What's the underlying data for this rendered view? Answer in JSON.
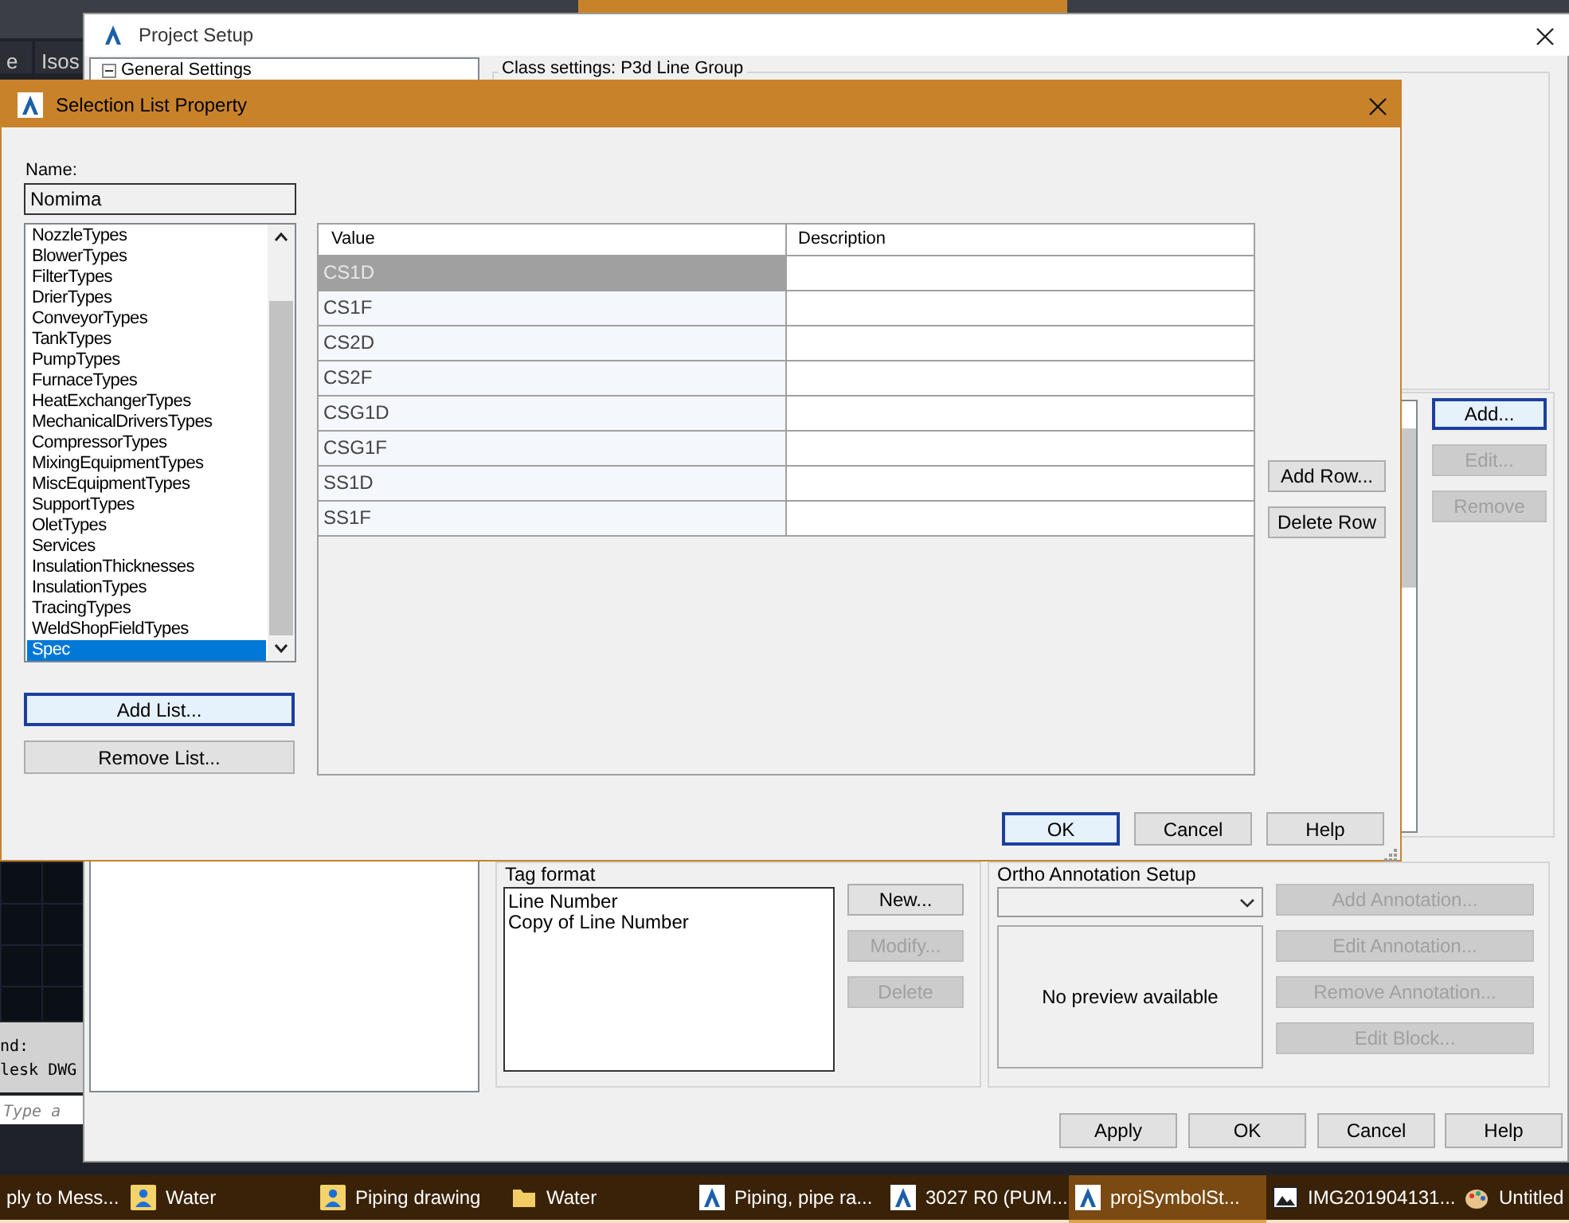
{
  "background_app": {
    "tabs": [
      {
        "label": "e"
      },
      {
        "label": "Isos"
      }
    ],
    "command_lines": [
      "nd:",
      "lesk DWG"
    ],
    "command_placeholder": "Type a"
  },
  "project_setup": {
    "title": "Project Setup",
    "tree": [
      {
        "label": "General Settings",
        "expanded": true
      }
    ],
    "class_settings_label": "Class settings: P3d Line Group",
    "side_buttons": [
      {
        "label": "Add...",
        "disabled": false,
        "focused": true
      },
      {
        "label": "Edit...",
        "disabled": true,
        "focused": false
      },
      {
        "label": "Remove",
        "disabled": true,
        "focused": false
      }
    ],
    "tag_format": {
      "legend": "Tag format",
      "items": [
        "Line Number",
        "Copy of Line Number"
      ],
      "buttons": [
        {
          "label": "New...",
          "disabled": false,
          "focused": false
        },
        {
          "label": "Modify...",
          "disabled": true,
          "focused": false
        },
        {
          "label": "Delete",
          "disabled": true,
          "focused": false
        }
      ]
    },
    "ortho_annotation": {
      "legend": "Ortho Annotation Setup",
      "preview_text": "No preview available",
      "buttons": [
        {
          "label": "Add Annotation...",
          "disabled": true,
          "focused": false
        },
        {
          "label": "Edit Annotation...",
          "disabled": true,
          "focused": false
        },
        {
          "label": "Remove Annotation...",
          "disabled": true,
          "focused": false
        },
        {
          "label": "Edit Block...",
          "disabled": true,
          "focused": false
        }
      ]
    },
    "footer_buttons": [
      {
        "label": "Apply",
        "disabled": false,
        "focused": false
      },
      {
        "label": "OK",
        "disabled": false,
        "focused": false
      },
      {
        "label": "Cancel",
        "disabled": false,
        "focused": false
      },
      {
        "label": "Help",
        "disabled": false,
        "focused": false
      }
    ]
  },
  "dialog": {
    "title": "Selection List Property",
    "name_label": "Name:",
    "name_value": "Nomima",
    "lists": [
      {
        "label": "NozzleTypes",
        "selected": false
      },
      {
        "label": "BlowerTypes",
        "selected": false
      },
      {
        "label": "FilterTypes",
        "selected": false
      },
      {
        "label": "DrierTypes",
        "selected": false
      },
      {
        "label": "ConveyorTypes",
        "selected": false
      },
      {
        "label": "TankTypes",
        "selected": false
      },
      {
        "label": "PumpTypes",
        "selected": false
      },
      {
        "label": "FurnaceTypes",
        "selected": false
      },
      {
        "label": "HeatExchangerTypes",
        "selected": false
      },
      {
        "label": "MechanicalDriversTypes",
        "selected": false
      },
      {
        "label": "CompressorTypes",
        "selected": false
      },
      {
        "label": "MixingEquipmentTypes",
        "selected": false
      },
      {
        "label": "MiscEquipmentTypes",
        "selected": false
      },
      {
        "label": "SupportTypes",
        "selected": false
      },
      {
        "label": "OletTypes",
        "selected": false
      },
      {
        "label": "Services",
        "selected": false
      },
      {
        "label": "InsulationThicknesses",
        "selected": false
      },
      {
        "label": "InsulationTypes",
        "selected": false
      },
      {
        "label": "TracingTypes",
        "selected": false
      },
      {
        "label": "WeldShopFieldTypes",
        "selected": false
      },
      {
        "label": "Spec",
        "selected": true
      }
    ],
    "list_buttons": [
      {
        "label": "Add List...",
        "disabled": false,
        "focused": true
      },
      {
        "label": "Remove List...",
        "disabled": false,
        "focused": false
      }
    ],
    "table": {
      "columns": [
        "Value",
        "Description"
      ],
      "rows": [
        {
          "value": "CS1D",
          "selected": true
        },
        {
          "value": "CS1F",
          "selected": false
        },
        {
          "value": "CS2D",
          "selected": false
        },
        {
          "value": "CS2F",
          "selected": false
        },
        {
          "value": "CSG1D",
          "selected": false
        },
        {
          "value": "CSG1F",
          "selected": false
        },
        {
          "value": "SS1D",
          "selected": false
        },
        {
          "value": "SS1F",
          "selected": false
        }
      ]
    },
    "row_buttons": [
      {
        "label": "Add Row...",
        "disabled": false,
        "focused": false
      },
      {
        "label": "Delete Row",
        "disabled": false,
        "focused": false
      }
    ],
    "footer_buttons": [
      {
        "label": "OK",
        "disabled": false,
        "focused": true
      },
      {
        "label": "Cancel",
        "disabled": false,
        "focused": false
      },
      {
        "label": "Help",
        "disabled": false,
        "focused": false
      }
    ]
  },
  "taskbar": [
    {
      "label": "ply to Mess...",
      "kind": "none",
      "selected": false
    },
    {
      "label": "Water",
      "kind": "contact",
      "selected": false
    },
    {
      "label": "Piping drawing",
      "kind": "contact",
      "selected": false
    },
    {
      "label": "Water",
      "kind": "folder",
      "selected": false
    },
    {
      "label": "Piping, pipe ra...",
      "kind": "app",
      "selected": false
    },
    {
      "label": "3027 R0 (PUM...",
      "kind": "app",
      "selected": false
    },
    {
      "label": "projSymbolSt...",
      "kind": "app",
      "selected": true
    },
    {
      "label": "IMG201904131...",
      "kind": "image",
      "selected": false
    },
    {
      "label": "Untitled",
      "kind": "paint",
      "selected": false
    }
  ]
}
